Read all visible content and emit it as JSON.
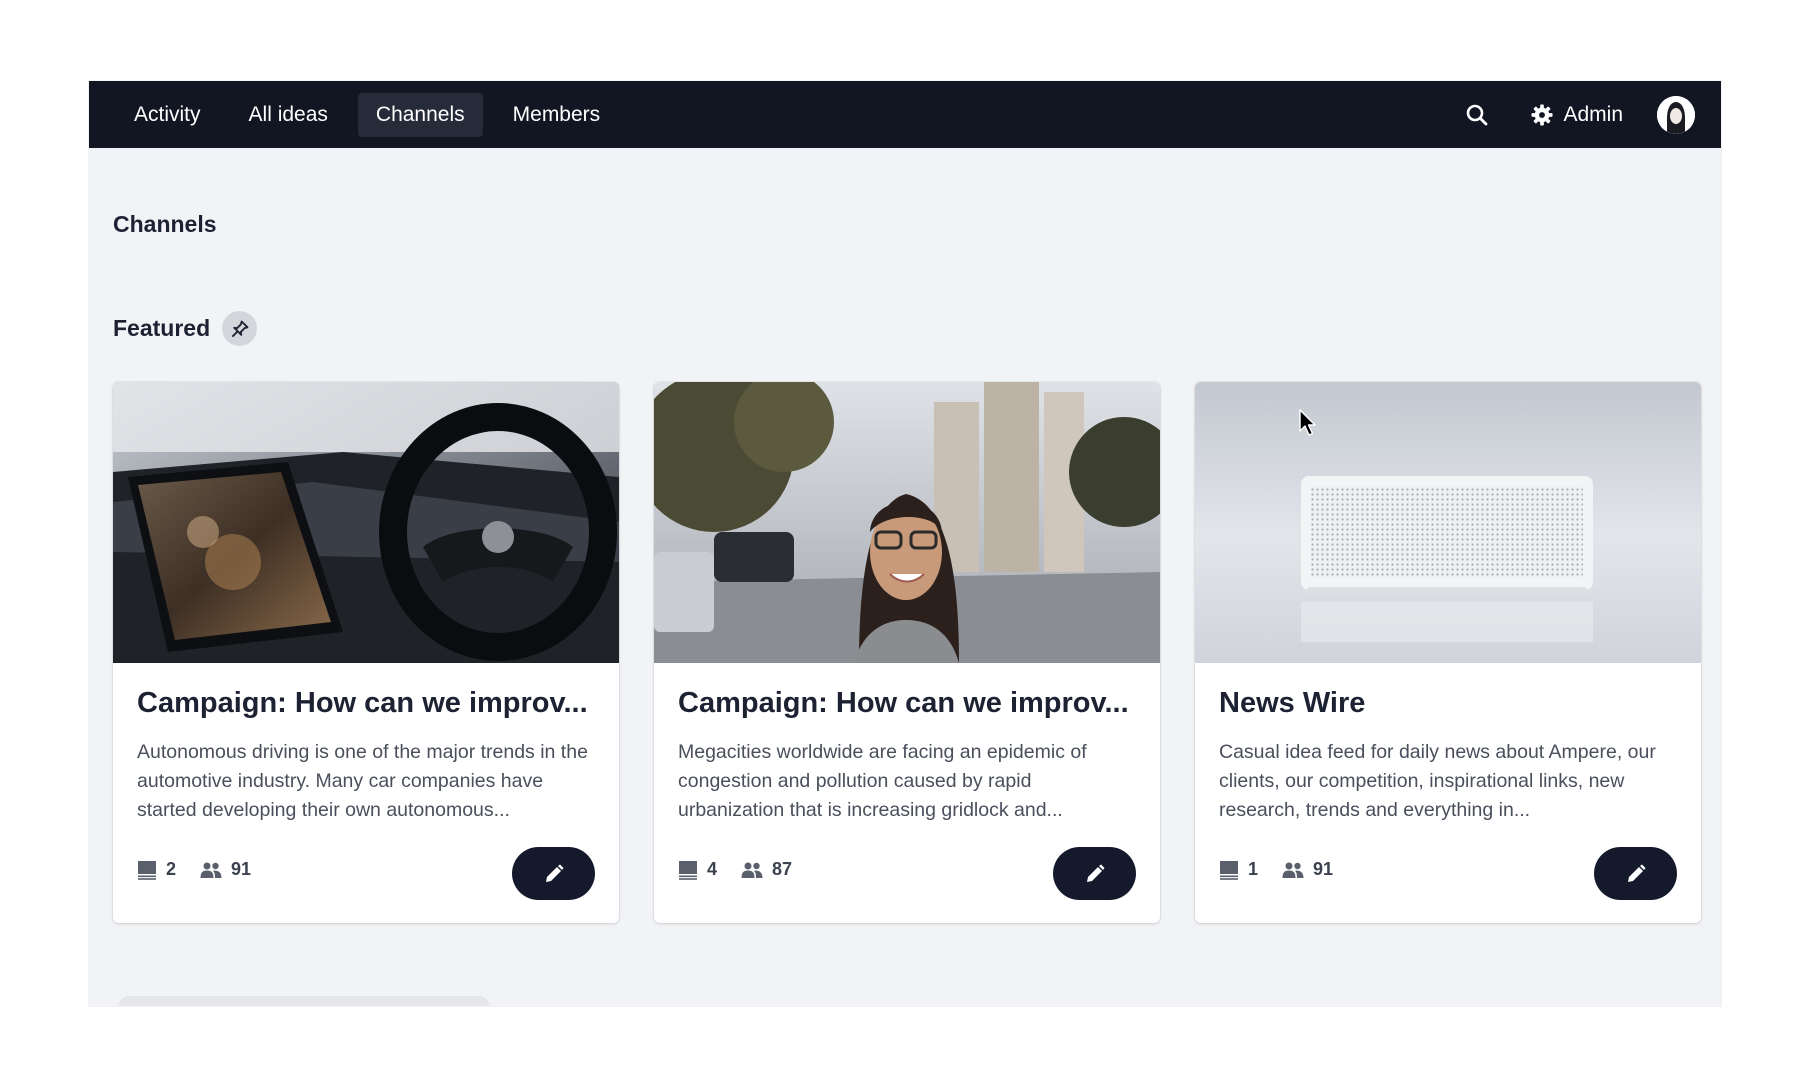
{
  "nav": {
    "tabs": [
      {
        "label": "Activity"
      },
      {
        "label": "All ideas"
      },
      {
        "label": "Channels",
        "active": true
      },
      {
        "label": "Members"
      }
    ],
    "search_icon": "search-icon",
    "admin_label": "Admin",
    "admin_icon": "gear-icon"
  },
  "page": {
    "title": "Channels",
    "featured_label": "Featured",
    "featured_icon": "pin-icon"
  },
  "cards": [
    {
      "title": "Campaign: How can we improv...",
      "description": "Autonomous driving is one of the major trends in the automotive industry. Many car companies have started developing their own autonomous...",
      "ideas_count": "2",
      "members_count": "91"
    },
    {
      "title": "Campaign: How can we improv...",
      "description": "Megacities worldwide are facing an epidemic of congestion and pollution caused by rapid urbanization that is increasing gridlock and...",
      "ideas_count": "4",
      "members_count": "87"
    },
    {
      "title": "News Wire",
      "description": "Casual idea feed for daily news about Ampere, our clients, our competition, inspirational links, new research, trends and everything in...",
      "ideas_count": "1",
      "members_count": "91"
    }
  ],
  "colors": {
    "nav_bg": "#121623",
    "page_bg": "#f2f3f6",
    "edit_button": "#141a2b"
  }
}
